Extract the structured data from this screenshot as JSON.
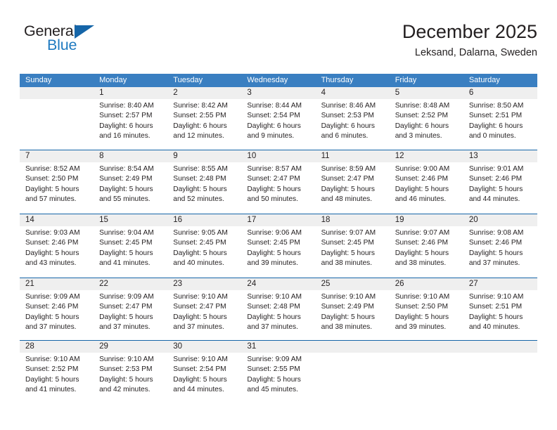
{
  "brand": {
    "word1": "General",
    "word2": "Blue",
    "logo_icon": "blue-triangle-logo",
    "accent_color": "#1565a8"
  },
  "header": {
    "title": "December 2025",
    "subtitle": "Leksand, Dalarna, Sweden"
  },
  "calendar": {
    "header_bg": "#3a7fc1",
    "row_divider_color": "#1565a8",
    "daynum_band_color": "#efefef",
    "weekdays": [
      "Sunday",
      "Monday",
      "Tuesday",
      "Wednesday",
      "Thursday",
      "Friday",
      "Saturday"
    ],
    "weeks": [
      [
        {
          "day": "",
          "sunrise": "",
          "sunset": "",
          "daylight1": "",
          "daylight2": ""
        },
        {
          "day": "1",
          "sunrise": "Sunrise: 8:40 AM",
          "sunset": "Sunset: 2:57 PM",
          "daylight1": "Daylight: 6 hours",
          "daylight2": "and 16 minutes."
        },
        {
          "day": "2",
          "sunrise": "Sunrise: 8:42 AM",
          "sunset": "Sunset: 2:55 PM",
          "daylight1": "Daylight: 6 hours",
          "daylight2": "and 12 minutes."
        },
        {
          "day": "3",
          "sunrise": "Sunrise: 8:44 AM",
          "sunset": "Sunset: 2:54 PM",
          "daylight1": "Daylight: 6 hours",
          "daylight2": "and 9 minutes."
        },
        {
          "day": "4",
          "sunrise": "Sunrise: 8:46 AM",
          "sunset": "Sunset: 2:53 PM",
          "daylight1": "Daylight: 6 hours",
          "daylight2": "and 6 minutes."
        },
        {
          "day": "5",
          "sunrise": "Sunrise: 8:48 AM",
          "sunset": "Sunset: 2:52 PM",
          "daylight1": "Daylight: 6 hours",
          "daylight2": "and 3 minutes."
        },
        {
          "day": "6",
          "sunrise": "Sunrise: 8:50 AM",
          "sunset": "Sunset: 2:51 PM",
          "daylight1": "Daylight: 6 hours",
          "daylight2": "and 0 minutes."
        }
      ],
      [
        {
          "day": "7",
          "sunrise": "Sunrise: 8:52 AM",
          "sunset": "Sunset: 2:50 PM",
          "daylight1": "Daylight: 5 hours",
          "daylight2": "and 57 minutes."
        },
        {
          "day": "8",
          "sunrise": "Sunrise: 8:54 AM",
          "sunset": "Sunset: 2:49 PM",
          "daylight1": "Daylight: 5 hours",
          "daylight2": "and 55 minutes."
        },
        {
          "day": "9",
          "sunrise": "Sunrise: 8:55 AM",
          "sunset": "Sunset: 2:48 PM",
          "daylight1": "Daylight: 5 hours",
          "daylight2": "and 52 minutes."
        },
        {
          "day": "10",
          "sunrise": "Sunrise: 8:57 AM",
          "sunset": "Sunset: 2:47 PM",
          "daylight1": "Daylight: 5 hours",
          "daylight2": "and 50 minutes."
        },
        {
          "day": "11",
          "sunrise": "Sunrise: 8:59 AM",
          "sunset": "Sunset: 2:47 PM",
          "daylight1": "Daylight: 5 hours",
          "daylight2": "and 48 minutes."
        },
        {
          "day": "12",
          "sunrise": "Sunrise: 9:00 AM",
          "sunset": "Sunset: 2:46 PM",
          "daylight1": "Daylight: 5 hours",
          "daylight2": "and 46 minutes."
        },
        {
          "day": "13",
          "sunrise": "Sunrise: 9:01 AM",
          "sunset": "Sunset: 2:46 PM",
          "daylight1": "Daylight: 5 hours",
          "daylight2": "and 44 minutes."
        }
      ],
      [
        {
          "day": "14",
          "sunrise": "Sunrise: 9:03 AM",
          "sunset": "Sunset: 2:46 PM",
          "daylight1": "Daylight: 5 hours",
          "daylight2": "and 43 minutes."
        },
        {
          "day": "15",
          "sunrise": "Sunrise: 9:04 AM",
          "sunset": "Sunset: 2:45 PM",
          "daylight1": "Daylight: 5 hours",
          "daylight2": "and 41 minutes."
        },
        {
          "day": "16",
          "sunrise": "Sunrise: 9:05 AM",
          "sunset": "Sunset: 2:45 PM",
          "daylight1": "Daylight: 5 hours",
          "daylight2": "and 40 minutes."
        },
        {
          "day": "17",
          "sunrise": "Sunrise: 9:06 AM",
          "sunset": "Sunset: 2:45 PM",
          "daylight1": "Daylight: 5 hours",
          "daylight2": "and 39 minutes."
        },
        {
          "day": "18",
          "sunrise": "Sunrise: 9:07 AM",
          "sunset": "Sunset: 2:45 PM",
          "daylight1": "Daylight: 5 hours",
          "daylight2": "and 38 minutes."
        },
        {
          "day": "19",
          "sunrise": "Sunrise: 9:07 AM",
          "sunset": "Sunset: 2:46 PM",
          "daylight1": "Daylight: 5 hours",
          "daylight2": "and 38 minutes."
        },
        {
          "day": "20",
          "sunrise": "Sunrise: 9:08 AM",
          "sunset": "Sunset: 2:46 PM",
          "daylight1": "Daylight: 5 hours",
          "daylight2": "and 37 minutes."
        }
      ],
      [
        {
          "day": "21",
          "sunrise": "Sunrise: 9:09 AM",
          "sunset": "Sunset: 2:46 PM",
          "daylight1": "Daylight: 5 hours",
          "daylight2": "and 37 minutes."
        },
        {
          "day": "22",
          "sunrise": "Sunrise: 9:09 AM",
          "sunset": "Sunset: 2:47 PM",
          "daylight1": "Daylight: 5 hours",
          "daylight2": "and 37 minutes."
        },
        {
          "day": "23",
          "sunrise": "Sunrise: 9:10 AM",
          "sunset": "Sunset: 2:47 PM",
          "daylight1": "Daylight: 5 hours",
          "daylight2": "and 37 minutes."
        },
        {
          "day": "24",
          "sunrise": "Sunrise: 9:10 AM",
          "sunset": "Sunset: 2:48 PM",
          "daylight1": "Daylight: 5 hours",
          "daylight2": "and 37 minutes."
        },
        {
          "day": "25",
          "sunrise": "Sunrise: 9:10 AM",
          "sunset": "Sunset: 2:49 PM",
          "daylight1": "Daylight: 5 hours",
          "daylight2": "and 38 minutes."
        },
        {
          "day": "26",
          "sunrise": "Sunrise: 9:10 AM",
          "sunset": "Sunset: 2:50 PM",
          "daylight1": "Daylight: 5 hours",
          "daylight2": "and 39 minutes."
        },
        {
          "day": "27",
          "sunrise": "Sunrise: 9:10 AM",
          "sunset": "Sunset: 2:51 PM",
          "daylight1": "Daylight: 5 hours",
          "daylight2": "and 40 minutes."
        }
      ],
      [
        {
          "day": "28",
          "sunrise": "Sunrise: 9:10 AM",
          "sunset": "Sunset: 2:52 PM",
          "daylight1": "Daylight: 5 hours",
          "daylight2": "and 41 minutes."
        },
        {
          "day": "29",
          "sunrise": "Sunrise: 9:10 AM",
          "sunset": "Sunset: 2:53 PM",
          "daylight1": "Daylight: 5 hours",
          "daylight2": "and 42 minutes."
        },
        {
          "day": "30",
          "sunrise": "Sunrise: 9:10 AM",
          "sunset": "Sunset: 2:54 PM",
          "daylight1": "Daylight: 5 hours",
          "daylight2": "and 44 minutes."
        },
        {
          "day": "31",
          "sunrise": "Sunrise: 9:09 AM",
          "sunset": "Sunset: 2:55 PM",
          "daylight1": "Daylight: 5 hours",
          "daylight2": "and 45 minutes."
        },
        {
          "day": "",
          "sunrise": "",
          "sunset": "",
          "daylight1": "",
          "daylight2": ""
        },
        {
          "day": "",
          "sunrise": "",
          "sunset": "",
          "daylight1": "",
          "daylight2": ""
        },
        {
          "day": "",
          "sunrise": "",
          "sunset": "",
          "daylight1": "",
          "daylight2": ""
        }
      ]
    ]
  }
}
